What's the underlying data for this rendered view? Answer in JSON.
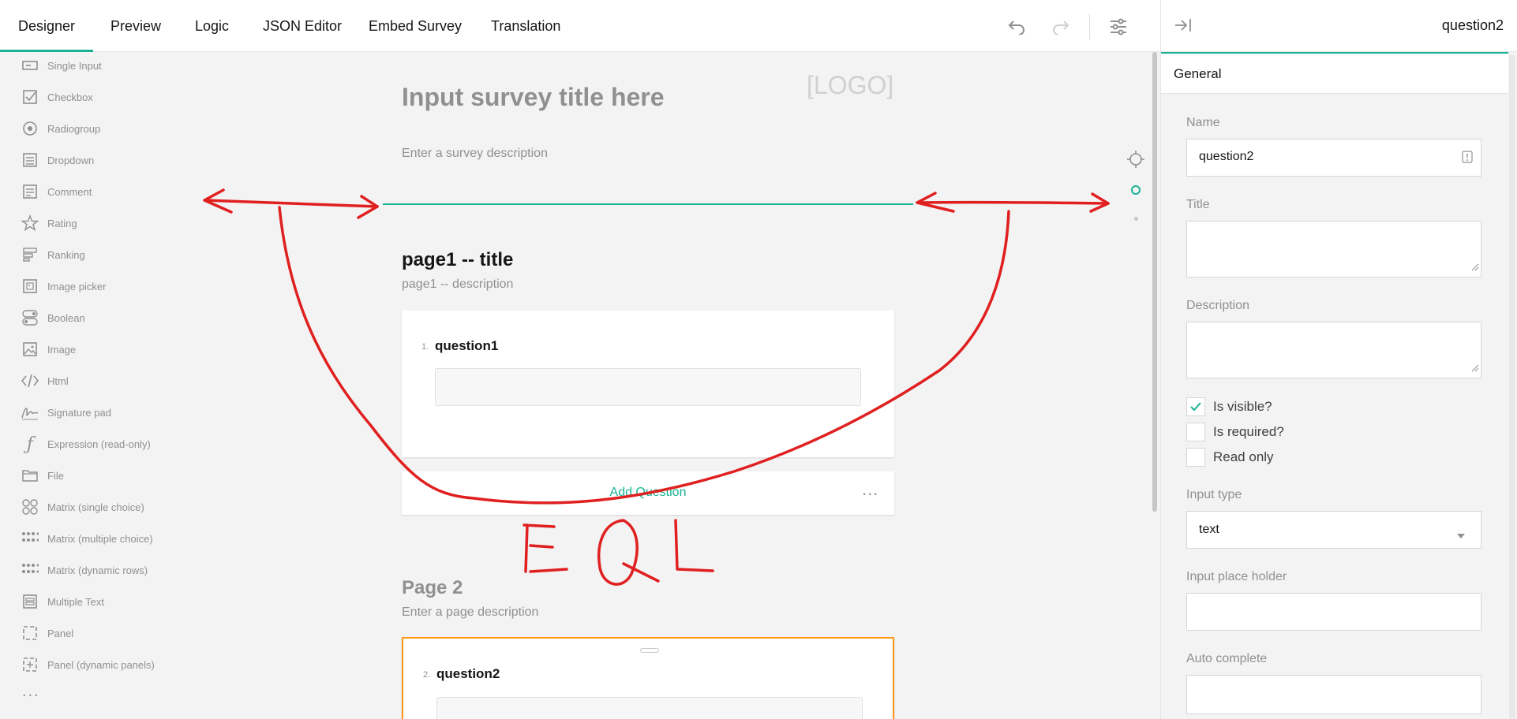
{
  "tabs": [
    "Designer",
    "Preview",
    "Logic",
    "JSON Editor",
    "Embed Survey",
    "Translation"
  ],
  "toolbox": {
    "items": [
      {
        "label": "Single Input",
        "icon": "single-input-icon"
      },
      {
        "label": "Checkbox",
        "icon": "checkbox-icon"
      },
      {
        "label": "Radiogroup",
        "icon": "radiogroup-icon"
      },
      {
        "label": "Dropdown",
        "icon": "dropdown-icon"
      },
      {
        "label": "Comment",
        "icon": "comment-icon"
      },
      {
        "label": "Rating",
        "icon": "rating-star-icon"
      },
      {
        "label": "Ranking",
        "icon": "ranking-icon"
      },
      {
        "label": "Image picker",
        "icon": "image-picker-icon"
      },
      {
        "label": "Boolean",
        "icon": "boolean-icon"
      },
      {
        "label": "Image",
        "icon": "image-icon"
      },
      {
        "label": "Html",
        "icon": "html-code-icon"
      },
      {
        "label": "Signature pad",
        "icon": "signature-icon"
      },
      {
        "label": "Expression (read-only)",
        "icon": "expression-icon"
      },
      {
        "label": "File",
        "icon": "folder-icon"
      },
      {
        "label": "Matrix (single choice)",
        "icon": "matrix-single-icon"
      },
      {
        "label": "Matrix (multiple choice)",
        "icon": "matrix-multiple-icon"
      },
      {
        "label": "Matrix (dynamic rows)",
        "icon": "matrix-dynamic-icon"
      },
      {
        "label": "Multiple Text",
        "icon": "multiple-text-icon"
      },
      {
        "label": "Panel",
        "icon": "panel-icon"
      },
      {
        "label": "Panel (dynamic panels)",
        "icon": "panel-dynamic-icon"
      }
    ],
    "more": "..."
  },
  "survey": {
    "title": "Input survey title here",
    "logo": "[LOGO]",
    "description": "Enter a survey description"
  },
  "pages": [
    {
      "title": "page1 -- title",
      "description": "page1 -- description",
      "question": {
        "number": "1.",
        "title": "question1"
      },
      "add_question": "Add Question",
      "more": "..."
    },
    {
      "title": "Page 2",
      "description": "Enter a page description",
      "question": {
        "number": "2.",
        "title": "question2"
      }
    }
  ],
  "annotation": {
    "text": "EQL",
    "color": "#e02020"
  },
  "property_grid": {
    "title": "question2",
    "tab": "General",
    "name_label": "Name",
    "name_value": "question2",
    "title_label": "Title",
    "description_label": "Description",
    "checks": [
      {
        "label": "Is visible?",
        "checked": true
      },
      {
        "label": "Is required?",
        "checked": false
      },
      {
        "label": "Read only",
        "checked": false
      }
    ],
    "input_type_label": "Input type",
    "input_type_value": "text",
    "placeholder_label": "Input place holder",
    "autocomplete_label": "Auto complete"
  },
  "colors": {
    "accent": "#19b394",
    "selected": "#ff9814",
    "annotation": "#e02020"
  }
}
